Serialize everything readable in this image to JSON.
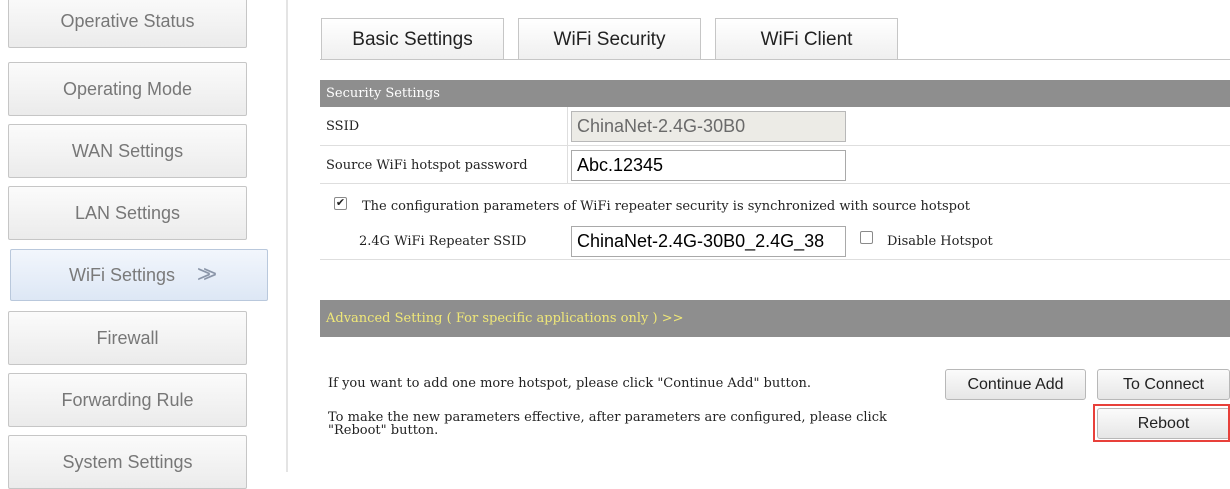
{
  "sidebar": {
    "items": [
      {
        "label": "Operative Status"
      },
      {
        "label": "Operating Mode"
      },
      {
        "label": "WAN Settings"
      },
      {
        "label": "LAN Settings"
      },
      {
        "label": "WiFi Settings",
        "arrows": ">>"
      },
      {
        "label": "Firewall"
      },
      {
        "label": "Forwarding Rule"
      },
      {
        "label": "System Settings"
      }
    ]
  },
  "tabs": [
    {
      "label": "Basic Settings"
    },
    {
      "label": "WiFi Security"
    },
    {
      "label": "WiFi Client"
    }
  ],
  "security": {
    "title": "Security Settings",
    "ssid_label": "SSID",
    "ssid_value": "ChinaNet-2.4G-30B0",
    "password_label": "Source WiFi hotspot password",
    "password_value": "Abc.12345",
    "sync_text": "The configuration parameters of WiFi repeater security is synchronized with source hotspot",
    "sync_checked": true,
    "repeater_label": "2.4G WiFi Repeater SSID",
    "repeater_value": "ChinaNet-2.4G-30B0_2.4G_38",
    "disable_label": "Disable Hotspot"
  },
  "advanced": {
    "title": "Advanced Setting ( For specific applications only ) >>"
  },
  "footer": {
    "add_text": "If you want to add one more hotspot, please click \"Continue Add\" button.",
    "continue_label": "Continue Add",
    "connect_label": "To Connect",
    "reboot_text_1": "To make the new parameters effective, after parameters are configured, please click",
    "reboot_text_2": "\"Reboot\" button.",
    "reboot_label": "Reboot"
  },
  "colors": {
    "section_bar": "#8e8e8e",
    "advanced_text": "#f0e878",
    "highlight": "#e8403a"
  }
}
